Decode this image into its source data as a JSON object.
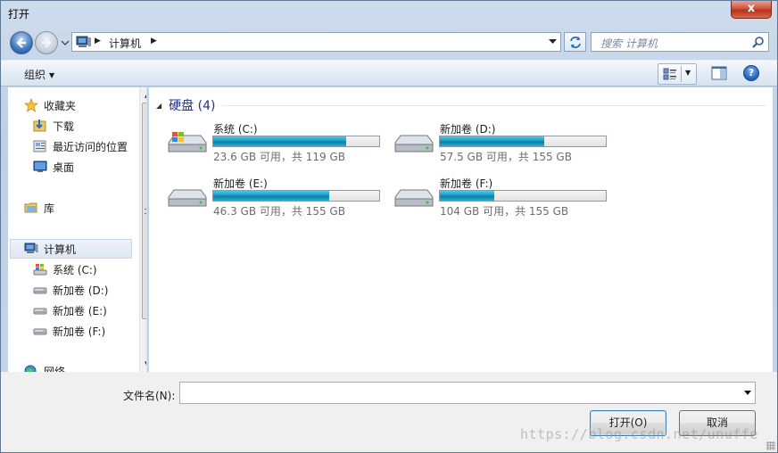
{
  "window": {
    "title": "打开"
  },
  "close_glyph": "x",
  "nav": {
    "breadcrumb": "计算机",
    "search_placeholder": "搜索 计算机"
  },
  "toolbar": {
    "organize_label": "组织"
  },
  "sidebar": {
    "items": [
      {
        "label": "收藏夹",
        "icon": "star-icon"
      },
      {
        "label": "下载",
        "icon": "download-folder-icon"
      },
      {
        "label": "最近访问的位置",
        "icon": "recent-places-icon"
      },
      {
        "label": "桌面",
        "icon": "desktop-icon"
      },
      {
        "label": "库",
        "icon": "library-icon"
      },
      {
        "label": "计算机",
        "icon": "computer-icon"
      },
      {
        "label": "系统 (C:)",
        "icon": "windows-drive-icon"
      },
      {
        "label": "新加卷 (D:)",
        "icon": "drive-icon"
      },
      {
        "label": "新加卷 (E:)",
        "icon": "drive-icon"
      },
      {
        "label": "新加卷 (F:)",
        "icon": "drive-icon"
      },
      {
        "label": "网络",
        "icon": "network-icon"
      }
    ]
  },
  "content": {
    "group_header": "硬盘 (4)",
    "drives": [
      {
        "name": "系统 (C:)",
        "free_text": "23.6 GB 可用，共 119 GB",
        "used_fraction": 0.8,
        "icon": "windows-drive-icon"
      },
      {
        "name": "新加卷 (D:)",
        "free_text": "57.5 GB 可用，共 155 GB",
        "used_fraction": 0.63,
        "icon": "drive-icon"
      },
      {
        "name": "新加卷 (E:)",
        "free_text": "46.3 GB 可用，共 155 GB",
        "used_fraction": 0.7,
        "icon": "drive-icon"
      },
      {
        "name": "新加卷 (F:)",
        "free_text": "104 GB 可用，共 155 GB",
        "used_fraction": 0.33,
        "icon": "drive-icon"
      }
    ]
  },
  "bottom": {
    "filename_label": "文件名(N):",
    "filename_value": "",
    "open_label": "打开(O)",
    "cancel_label": "取消",
    "watermark": "https://blog.csdn.net/unuffe"
  },
  "colors": {
    "accent": "#1c9dc4",
    "group_header": "#1e3287",
    "close": "#c7452c"
  }
}
